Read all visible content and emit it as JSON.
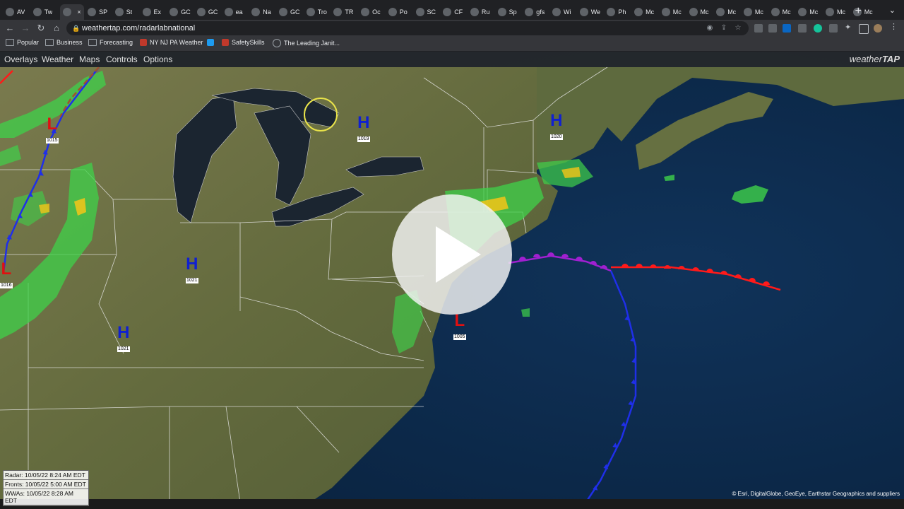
{
  "browser": {
    "tabs": [
      "AV",
      "Tw",
      "",
      "SP",
      "St",
      "Ex",
      "GC",
      "GC",
      "ea",
      "Na",
      "GC",
      "Tro",
      "TR",
      "Oc",
      "Po",
      "SC",
      "CF",
      "Ru",
      "Sp",
      "gfs",
      "Wi",
      "We",
      "Ph",
      "Mc",
      "Mc",
      "Mc",
      "Mc",
      "Mc",
      "Mc",
      "Mc",
      "Mc",
      "Mc"
    ],
    "active_tab_close": "×",
    "new_tab": "+",
    "url": "weathertap.com/radarlabnational",
    "bookmarks": [
      "Popular",
      "Business",
      "Forecasting",
      "NY NJ PA Weather",
      "SafetySkills",
      "The Leading Janit..."
    ]
  },
  "app": {
    "menus": [
      "Overlays",
      "Weather",
      "Maps",
      "Controls",
      "Options"
    ],
    "brand_light": "weather",
    "brand_bold": "TAP",
    "timestamps": {
      "radar": "Radar: 10/05/22 8:24 AM EDT",
      "fronts": "Fronts: 10/05/22 5:00 AM EDT",
      "wwas": "WWAs: 10/05/22 8:28 AM EDT"
    },
    "attribution": "© Esri, DigitalGlobe, GeoEye, Earthstar Geographics and suppliers"
  },
  "pressure_systems": [
    {
      "type": "L",
      "pressure": "1015",
      "color": "#e01010"
    },
    {
      "type": "H",
      "pressure": "1019",
      "color": "#1020d0"
    },
    {
      "type": "H",
      "pressure": "1020",
      "color": "#1020d0"
    },
    {
      "type": "L",
      "pressure": "1016",
      "color": "#e01010"
    },
    {
      "type": "H",
      "pressure": "1021",
      "color": "#1020d0"
    },
    {
      "type": "H",
      "pressure": "1021",
      "color": "#1020d0"
    },
    {
      "type": "L",
      "pressure": "1005",
      "color": "#e01010"
    }
  ],
  "colors": {
    "cold_front": "#1f2fe8",
    "warm_front": "#ff1a1a",
    "occluded_front": "#a020d0",
    "radar_light": "#3fd14a",
    "radar_heavy": "#f5c518",
    "land": "#6d7344",
    "ocean": "#0f2a4a"
  }
}
